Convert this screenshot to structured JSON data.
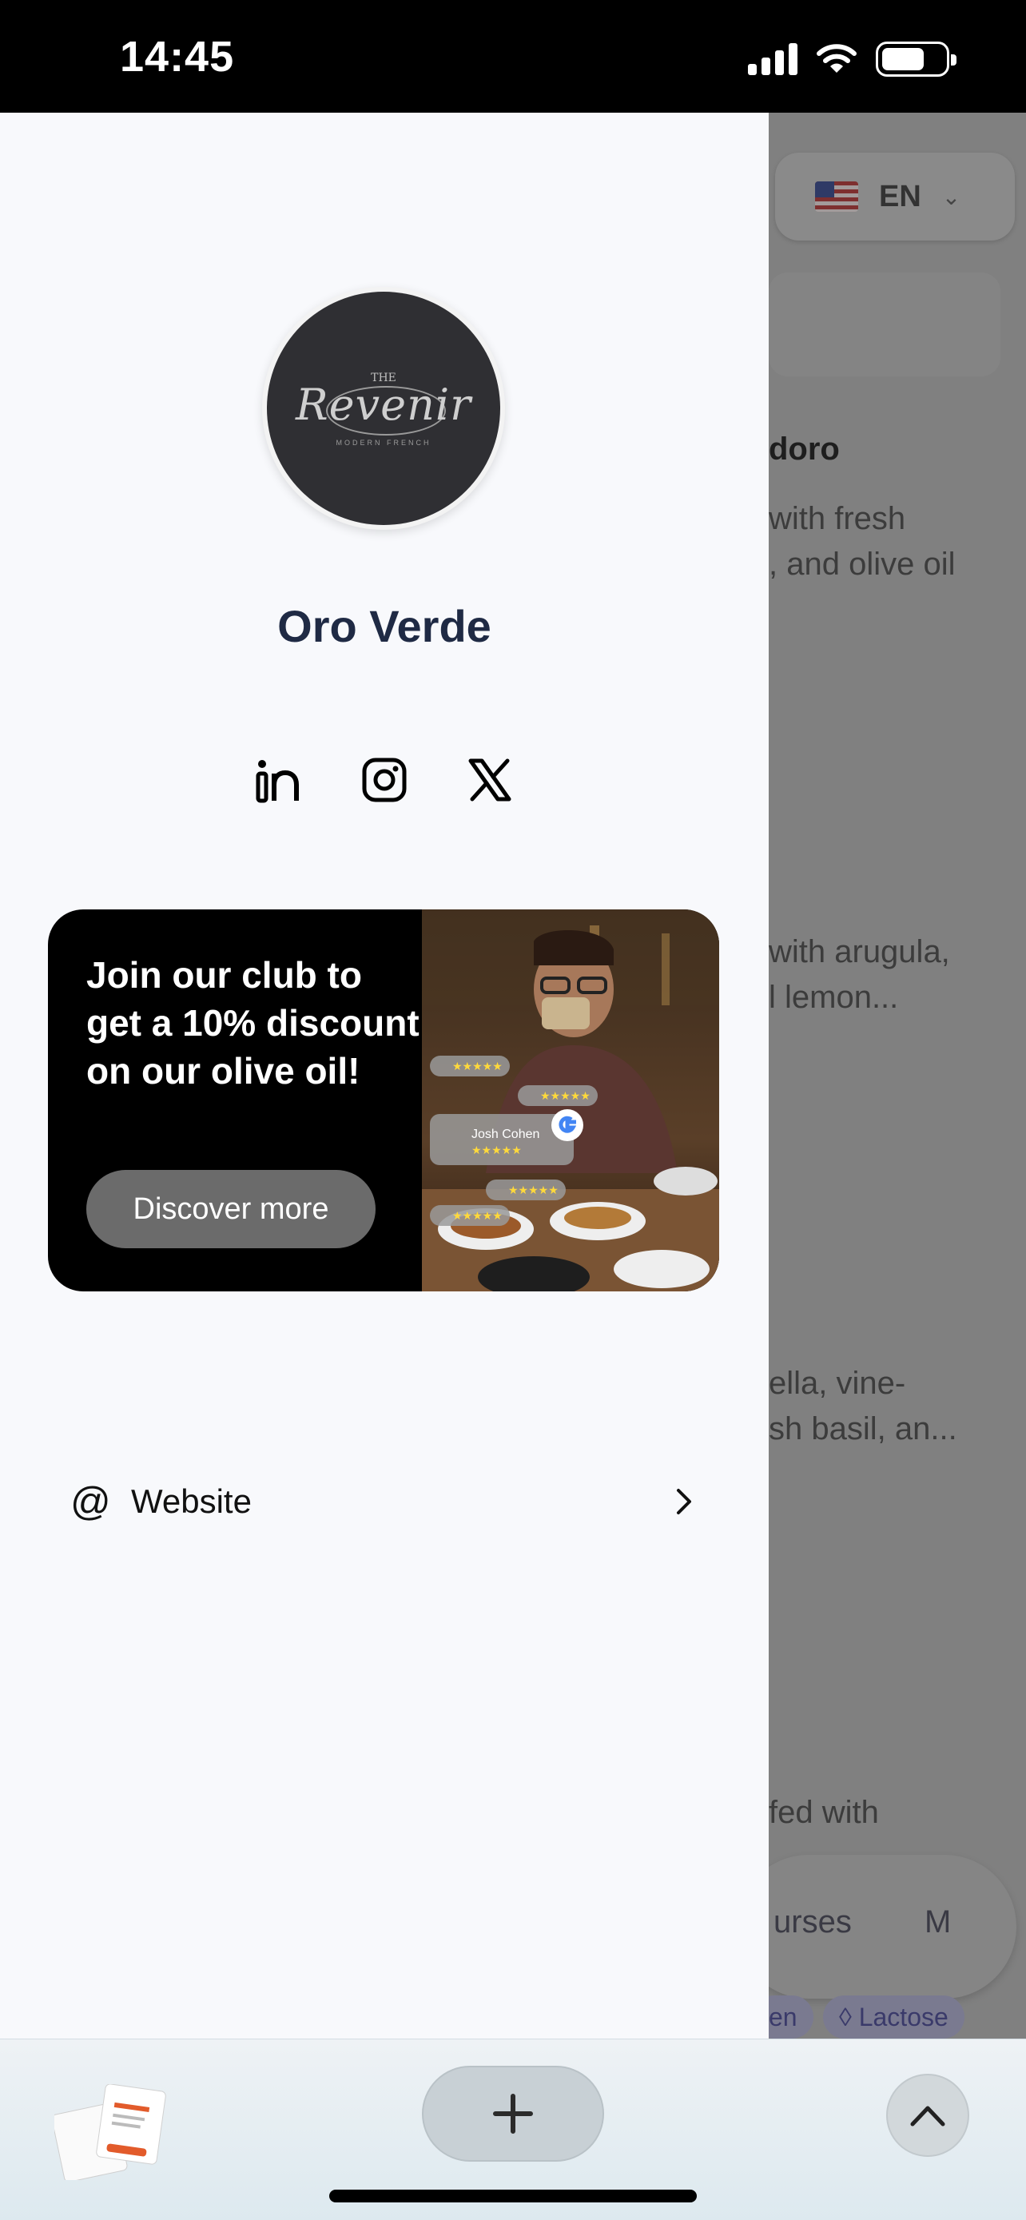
{
  "status_bar": {
    "time": "14:45"
  },
  "background_page": {
    "language": {
      "code": "EN"
    },
    "texts": [
      {
        "text": "doro",
        "bold": true
      },
      {
        "text": "with fresh"
      },
      {
        "text": ", and olive oil"
      },
      {
        "text": "with arugula,"
      },
      {
        "text": "l lemon..."
      },
      {
        "text": "ella, vine-"
      },
      {
        "text": "sh basil, an..."
      },
      {
        "text": "fed with"
      }
    ],
    "courses_pill": {
      "label": "urses",
      "next": "M"
    },
    "tags": [
      {
        "label": "en"
      },
      {
        "label": "Lactose"
      }
    ]
  },
  "drawer": {
    "logo": {
      "the": "THE",
      "name": "Revenir",
      "sub": "MODERN FRENCH"
    },
    "name": "Oro Verde",
    "socials": [
      "linkedin-icon",
      "instagram-icon",
      "x-icon"
    ],
    "promo": {
      "text": "Join our club to get a 10% discount on our olive oil!",
      "button": "Discover more",
      "review_name": "Josh Cohen"
    },
    "links": [
      {
        "icon": "@",
        "label": "Website"
      }
    ]
  },
  "colors": {
    "drawer_bg": "#f8f9fc",
    "name_color": "#1f2a44",
    "promo_bg": "#000000",
    "promo_button": "#6b6b6b"
  }
}
